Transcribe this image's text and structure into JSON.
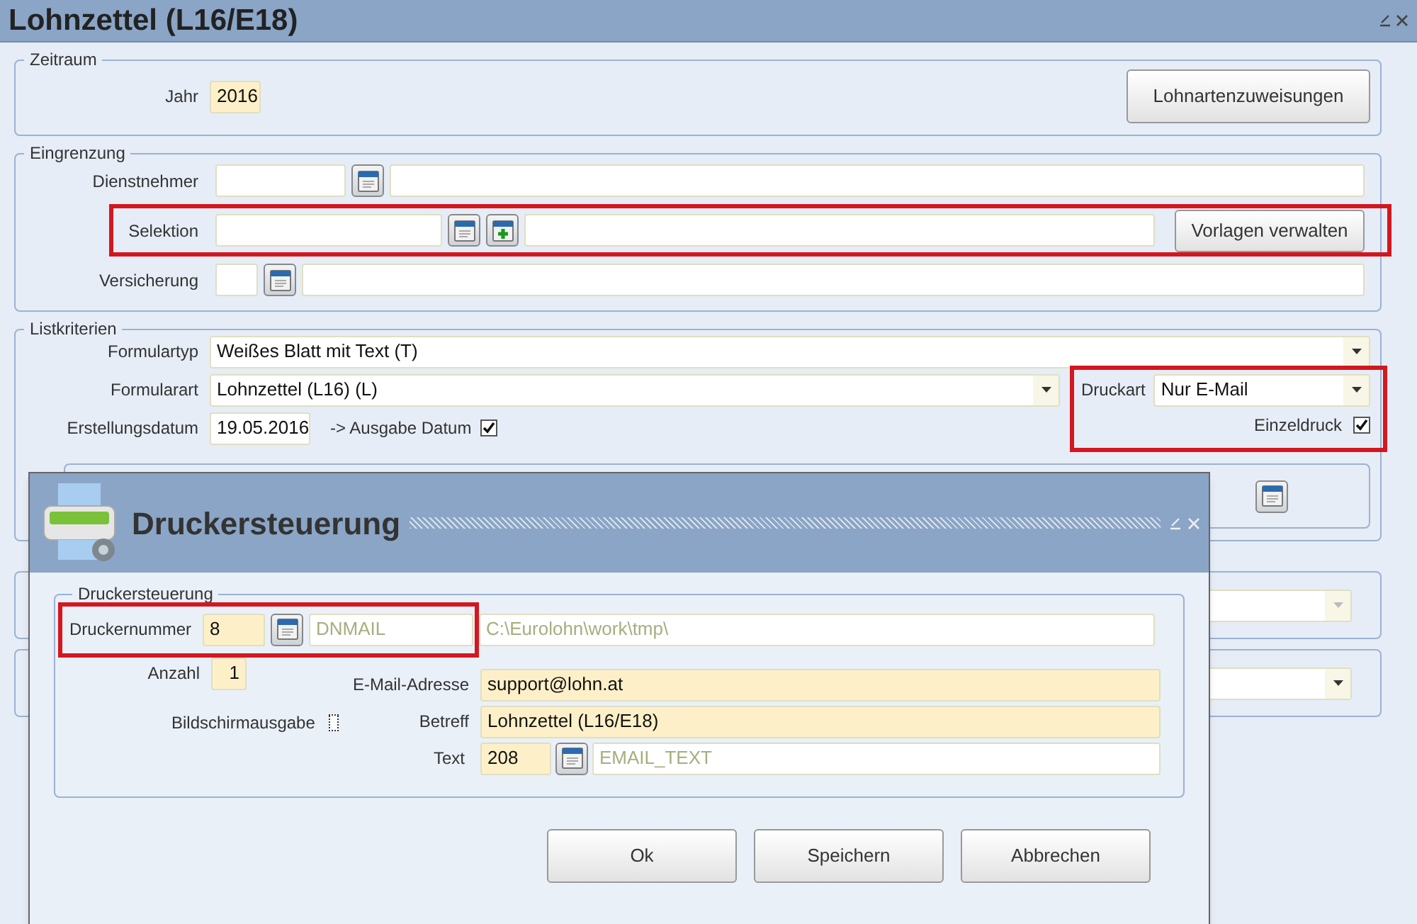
{
  "window": {
    "title": "Lohnzettel (L16/E18)"
  },
  "zeitraum": {
    "legend": "Zeitraum",
    "jahr": {
      "label": "Jahr",
      "value": "2016"
    },
    "button": "Lohnartenzuweisungen"
  },
  "eingrenzung": {
    "legend": "Eingrenzung",
    "rows": [
      {
        "label": "Dienstnehmer",
        "highlighted": false,
        "add_icon": false
      },
      {
        "label": "Selektion",
        "highlighted": true,
        "add_icon": true,
        "button": "Vorlagen verwalten"
      },
      {
        "label": "Versicherung",
        "highlighted": false,
        "add_icon": false
      }
    ]
  },
  "listkriterien": {
    "legend": "Listkriterien",
    "formulartyp": {
      "label": "Formulartyp",
      "value": "Weißes Blatt mit Text (T)"
    },
    "formularart": {
      "label": "Formularart",
      "value": "Lohnzettel (L16) (L)"
    },
    "erstellungsdatum": {
      "label": "Erstellungsdatum",
      "value": "19.05.2016"
    },
    "ausgabe_datum": {
      "label": "-> Ausgabe Datum",
      "checked": true
    },
    "druck": {
      "highlighted": true,
      "druckart": {
        "label": "Druckart",
        "value": "Nur E-Mail"
      },
      "einzeldruck": {
        "label": "Einzeldruck",
        "checked": true
      }
    }
  },
  "dialog": {
    "title": "Druckersteuerung",
    "legend": "Druckersteuerung",
    "druckernummer": {
      "label": "Druckernummer",
      "value": "8",
      "name": "DNMAIL",
      "path": "C:\\Eurolohn\\work\\tmp\\",
      "highlighted": true
    },
    "anzahl": {
      "label": "Anzahl",
      "value": "1"
    },
    "bildschirmausgabe": {
      "label": "Bildschirmausgabe",
      "checked": false
    },
    "email": {
      "label": "E-Mail-Adresse",
      "value": "support@lohn.at"
    },
    "betreff": {
      "label": "Betreff",
      "value": "Lohnzettel (L16/E18)"
    },
    "text": {
      "label": "Text",
      "value": "208",
      "name": "EMAIL_TEXT"
    },
    "buttons": [
      "Ok",
      "Speichern",
      "Abbrechen"
    ]
  }
}
